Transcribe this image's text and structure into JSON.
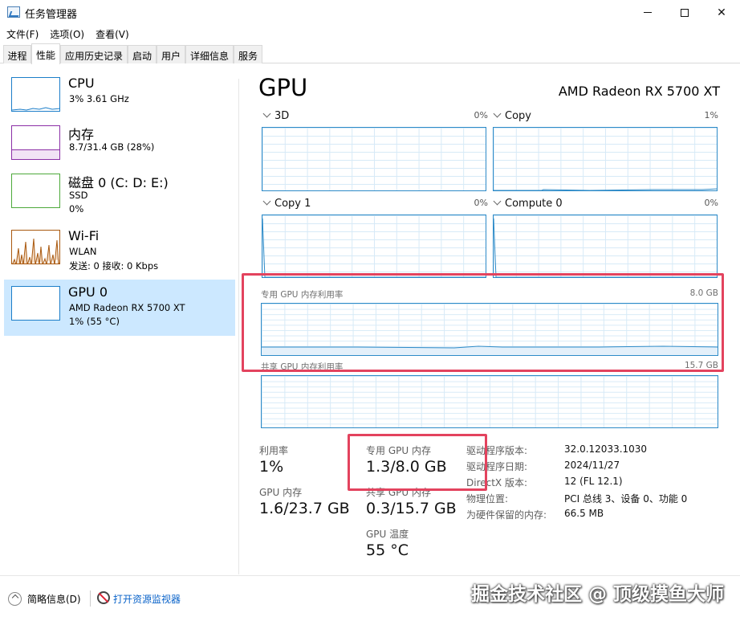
{
  "window": {
    "title": "任务管理器"
  },
  "menu": [
    "文件(F)",
    "选项(O)",
    "查看(V)"
  ],
  "tabs": [
    "进程",
    "性能",
    "应用历史记录",
    "启动",
    "用户",
    "详细信息",
    "服务"
  ],
  "resources": [
    {
      "name": "CPU",
      "line2": "3% 3.61 GHz",
      "line3": "",
      "color": "#1c7ec9"
    },
    {
      "name": "内存",
      "line2": "8.7/31.4 GB (28%)",
      "line3": "",
      "color": "#8b2fa6"
    },
    {
      "name": "磁盘 0 (C: D: E:)",
      "line2": "SSD",
      "line3": "0%",
      "color": "#4da93a"
    },
    {
      "name": "Wi-Fi",
      "line2": "WLAN",
      "line3": "发送: 0 接收: 0 Kbps",
      "color": "#a9580e"
    },
    {
      "name": "GPU 0",
      "line2": "AMD Radeon RX 5700 XT",
      "line3": "1% (55 °C)",
      "color": "#1c7ec9"
    }
  ],
  "gpu": {
    "title": "GPU",
    "model": "AMD Radeon RX 5700 XT",
    "engines": [
      {
        "label": "3D",
        "value": "0%"
      },
      {
        "label": "Copy",
        "value": "1%"
      },
      {
        "label": "Copy 1",
        "value": "0%"
      },
      {
        "label": "Compute 0",
        "value": "0%"
      }
    ],
    "dedicated": {
      "label": "专用 GPU 内存利用率",
      "max": "8.0 GB"
    },
    "shared": {
      "label": "共享 GPU 内存利用率",
      "max": "15.7 GB"
    }
  },
  "stats": {
    "utilization_label": "利用率",
    "utilization": "1%",
    "dedicated_label": "专用 GPU 内存",
    "dedicated": "1.3/8.0 GB",
    "gpu_mem_label": "GPU 内存",
    "gpu_mem": "1.6/23.7 GB",
    "shared_label": "共享 GPU 内存",
    "shared": "0.3/15.7 GB",
    "temp_label": "GPU 温度",
    "temp": "55 °C"
  },
  "details": [
    {
      "k": "驱动程序版本:",
      "v": "32.0.12033.1030"
    },
    {
      "k": "驱动程序日期:",
      "v": "2024/11/27"
    },
    {
      "k": "DirectX 版本:",
      "v": "12 (FL 12.1)"
    },
    {
      "k": "物理位置:",
      "v": "PCI 总线 3、设备 0、功能 0"
    },
    {
      "k": "为硬件保留的内存:",
      "v": "66.5 MB"
    }
  ],
  "footer": {
    "summary": "简略信息(D)",
    "open_monitor": "打开资源监视器"
  },
  "watermark": "掘金技术社区 @ 顶级摸鱼大师",
  "highlight_color": "#e3435e"
}
